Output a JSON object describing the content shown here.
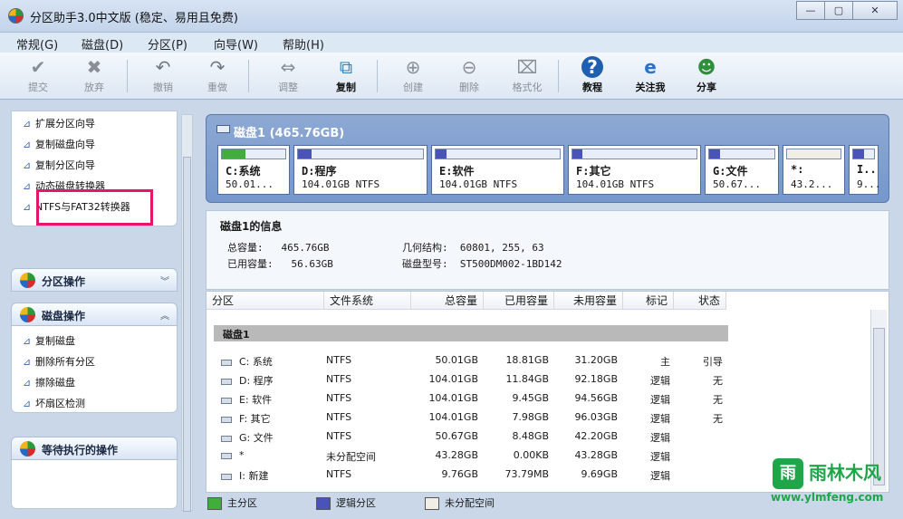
{
  "window": {
    "title": "分区助手3.0中文版 (稳定、易用且免费)",
    "minimize": "—",
    "maximize": "▢",
    "close": "✕"
  },
  "menu": [
    "常规(G)",
    "磁盘(D)",
    "分区(P)",
    "向导(W)",
    "帮助(H)"
  ],
  "toolbar": [
    {
      "label": "提交",
      "icon": "check-icon",
      "glyph": "✔",
      "enabled": false
    },
    {
      "label": "放弃",
      "icon": "x-icon",
      "glyph": "✖",
      "enabled": false
    },
    {
      "label": "撤销",
      "icon": "undo-icon",
      "glyph": "↶",
      "enabled": false
    },
    {
      "label": "重做",
      "icon": "redo-icon",
      "glyph": "↷",
      "enabled": false
    },
    {
      "label": "调整",
      "icon": "resize-disk-icon",
      "glyph": "⇔",
      "enabled": false
    },
    {
      "label": "复制",
      "icon": "copy-disk-icon",
      "glyph": "⧉",
      "enabled": true
    },
    {
      "label": "创建",
      "icon": "create-disk-icon",
      "glyph": "⊕",
      "enabled": false
    },
    {
      "label": "删除",
      "icon": "delete-disk-icon",
      "glyph": "⊖",
      "enabled": false
    },
    {
      "label": "格式化",
      "icon": "format-disk-icon",
      "glyph": "⌧",
      "enabled": false
    },
    {
      "label": "教程",
      "icon": "help-icon",
      "glyph": "?",
      "enabled": true
    },
    {
      "label": "关注我",
      "icon": "ie-icon",
      "glyph": "e",
      "enabled": true
    },
    {
      "label": "分享",
      "icon": "share-icon",
      "glyph": "☻",
      "enabled": true
    }
  ],
  "wizard_items": [
    "扩展分区向导",
    "复制磁盘向导",
    "复制分区向导",
    "动态磁盘转换器",
    "NTFS与FAT32转换器"
  ],
  "groups": {
    "partition_ops": "分区操作",
    "disk_ops": "磁盘操作",
    "pending_ops": "等待执行的操作"
  },
  "disk_ops_items": [
    "复制磁盘",
    "删除所有分区",
    "擦除磁盘",
    "坏扇区检测"
  ],
  "disk": {
    "title": "磁盘1 (465.76GB)",
    "partitions": [
      {
        "name": "C:系统",
        "size": "50.01...",
        "type": "primary",
        "used": 0.37
      },
      {
        "name": "D:程序",
        "size": "104.01GB NTFS",
        "type": "logical",
        "used": 0.11
      },
      {
        "name": "E:软件",
        "size": "104.01GB NTFS",
        "type": "logical",
        "used": 0.09
      },
      {
        "name": "F:其它",
        "size": "104.01GB NTFS",
        "type": "logical",
        "used": 0.08
      },
      {
        "name": "G:文件",
        "size": "50.67...",
        "type": "logical",
        "used": 0.17
      },
      {
        "name": "*:",
        "size": "43.2...",
        "type": "unallocated",
        "used": 0
      },
      {
        "name": "I..",
        "size": "9...",
        "type": "logical",
        "used": 0.5
      }
    ]
  },
  "info": {
    "heading": "磁盘1的信息",
    "total_label": "总容量:",
    "total_value": "465.76GB",
    "used_label": "已用容量:",
    "used_value": "56.63GB",
    "geometry_label": "几何结构:",
    "geometry_value": "60801, 255, 63",
    "model_label": "磁盘型号:",
    "model_value": "ST500DM002-1BD142"
  },
  "table": {
    "headers": [
      "分区",
      "文件系统",
      "总容量",
      "已用容量",
      "未用容量",
      "标记",
      "状态"
    ],
    "group": "磁盘1",
    "rows": [
      [
        "C: 系统",
        "NTFS",
        "50.01GB",
        "18.81GB",
        "31.20GB",
        "主",
        "引导"
      ],
      [
        "D: 程序",
        "NTFS",
        "104.01GB",
        "11.84GB",
        "92.18GB",
        "逻辑",
        "无"
      ],
      [
        "E: 软件",
        "NTFS",
        "104.01GB",
        "9.45GB",
        "94.56GB",
        "逻辑",
        "无"
      ],
      [
        "F: 其它",
        "NTFS",
        "104.01GB",
        "7.98GB",
        "96.03GB",
        "逻辑",
        "无"
      ],
      [
        "G: 文件",
        "NTFS",
        "50.67GB",
        "8.48GB",
        "42.20GB",
        "逻辑",
        ""
      ],
      [
        "*",
        "未分配空间",
        "43.28GB",
        "0.00KB",
        "43.28GB",
        "逻辑",
        ""
      ],
      [
        "I: 新建",
        "NTFS",
        "9.76GB",
        "73.79MB",
        "9.69GB",
        "逻辑",
        ""
      ]
    ]
  },
  "legend": [
    "主分区",
    "逻辑分区",
    "未分配空间"
  ],
  "colors": {
    "primary": "#3fae3a",
    "logical": "#4a53b8",
    "unallocated": "#f1eee6"
  },
  "watermark": {
    "logo": "雨林木风",
    "url": "www.ylmfeng.com"
  }
}
